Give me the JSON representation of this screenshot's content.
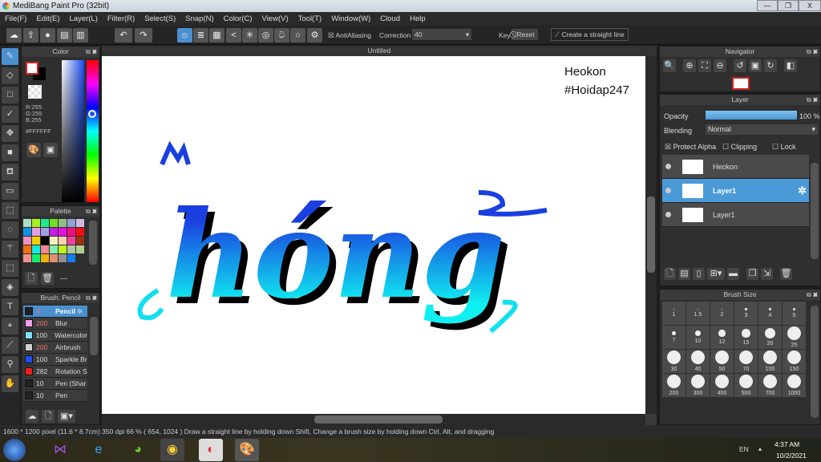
{
  "window": {
    "title": "MediBang Paint Pro (32bit)",
    "minimize": "—",
    "restore": "❐",
    "close": "X"
  },
  "menu": [
    "File(F)",
    "Edit(E)",
    "Layer(L)",
    "Filter(R)",
    "Select(S)",
    "Snap(N)",
    "Color(C)",
    "View(V)",
    "Tool(T)",
    "Window(W)",
    "Cloud",
    "Help"
  ],
  "toolbar": {
    "antialiasing": "AntiAliasing",
    "correction_label": "Correction",
    "correction_value": "40",
    "key_label": "Key",
    "reset": "Reset",
    "straight_line": "Create a straight line"
  },
  "color_panel": {
    "title": "Color",
    "r": "R:255",
    "g": "G:255",
    "b": "B:255",
    "hex": "#FFFFFF",
    "foreground": "#FFFFFF",
    "background": "#000000"
  },
  "palette": {
    "title": "Palette",
    "name": "---",
    "colors": [
      "#a8e0c0",
      "#a8f020",
      "#20e890",
      "#70e020",
      "#90c080",
      "#90a0d0",
      "#d0b8e0",
      "#1090e0",
      "#e0a0e0",
      "#a0a0e0",
      "#c020e0",
      "#e010e0",
      "#f01080",
      "#f01010",
      "#f090c0",
      "#f0d000",
      "#000000",
      "#f8f0c0",
      "#f8d0b0",
      "#f040a0",
      "#a03010",
      "#f07010",
      "#10e8e0",
      "#f08890",
      "#80f0b0",
      "#c0f020",
      "#b0c8a0",
      "#b0d090",
      "#f09090",
      "#10f070",
      "#f0b010",
      "#e09070",
      "#909090",
      "#1080f0"
    ]
  },
  "brush_panel": {
    "title": "Brush: Pencil",
    "items": [
      {
        "size": "4",
        "name": "Pencil",
        "color": "#222222",
        "selected": true
      },
      {
        "size": "200",
        "name": "Blur",
        "color": "#f0a0e8"
      },
      {
        "size": "100",
        "name": "Watercolor",
        "color": "#80e0f8"
      },
      {
        "size": "200",
        "name": "Airbrush",
        "color": "#d0d0d0"
      },
      {
        "size": "100",
        "name": "Sparkle Br",
        "color": "#2050f0"
      },
      {
        "size": "282",
        "name": "Rotation S",
        "color": "#f02020"
      },
      {
        "size": "10",
        "name": "Pen (Shar",
        "color": "#222222"
      },
      {
        "size": "10",
        "name": "Pen",
        "color": "#222222"
      }
    ]
  },
  "canvas": {
    "tab": "Untitled",
    "watermark_line1": "Heokon",
    "watermark_line2": "#Hoidap247",
    "art_text": "hóng",
    "gradient_top": "#1a3fe0",
    "gradient_bottom": "#10f0f0"
  },
  "navigator": {
    "title": "Navigator"
  },
  "layer_panel": {
    "title": "Layer",
    "opacity_label": "Opacity",
    "opacity_value": "100 %",
    "opacity": 100,
    "blending_label": "Blending",
    "blending_value": "Normal",
    "protect_alpha": "Protect Alpha",
    "clipping": "Clipping",
    "lock": "Lock",
    "layers": [
      {
        "name": "Heokon",
        "selected": false
      },
      {
        "name": "Layer1",
        "selected": true
      },
      {
        "name": "Layer1",
        "selected": false
      }
    ]
  },
  "brush_size": {
    "title": "Brush Size",
    "sizes": [
      "1",
      "1.5",
      "2",
      "3",
      "4",
      "5",
      "7",
      "10",
      "12",
      "15",
      "20",
      "25",
      "30",
      "40",
      "50",
      "70",
      "100",
      "150",
      "200",
      "300",
      "400",
      "500",
      "700",
      "1000"
    ]
  },
  "status": {
    "text": "1600 * 1200 pixel   (11.6 * 8.7cm)   350 dpi   66 %   ( 654, 1024 )   Draw a straight line by holding down Shift, Change a brush size by holding down Ctrl, Alt, and dragging"
  },
  "taskbar": {
    "lang": "EN",
    "time": "4:37 AM",
    "date": "10/2/2021"
  }
}
